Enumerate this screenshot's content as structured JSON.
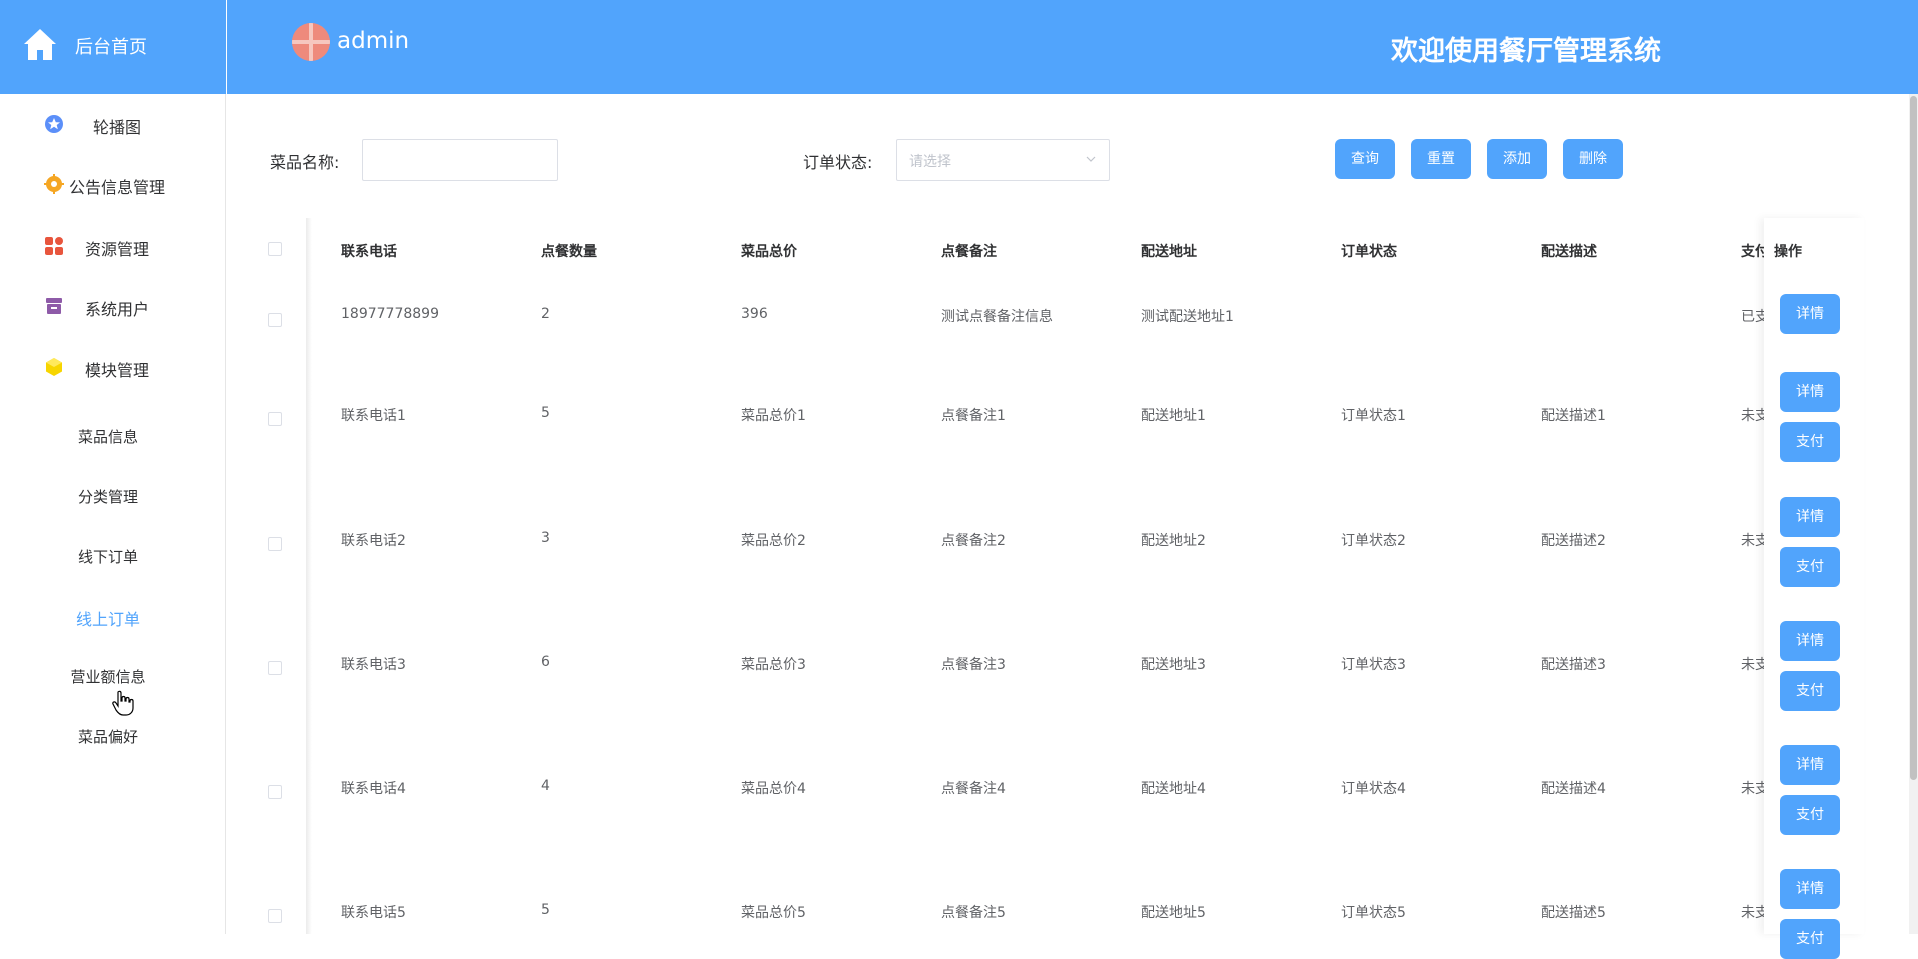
{
  "brand": {
    "label": "后台首页"
  },
  "header": {
    "user": "admin",
    "welcome": "欢迎使用餐厅管理系统"
  },
  "sidebar": {
    "items": [
      {
        "label": "轮播图",
        "icon": "star-icon"
      },
      {
        "label": "公告信息管理",
        "icon": "gear-icon"
      },
      {
        "label": "资源管理",
        "icon": "grid-icon"
      },
      {
        "label": "系统用户",
        "icon": "archive-icon"
      },
      {
        "label": "模块管理",
        "icon": "cube-icon"
      }
    ],
    "subitems": [
      {
        "label": "菜品信息"
      },
      {
        "label": "分类管理"
      },
      {
        "label": "线下订单"
      },
      {
        "label": "线上订单"
      },
      {
        "label": "营业额信息"
      },
      {
        "label": "菜品偏好"
      }
    ]
  },
  "search": {
    "name_label": "菜品名称:",
    "name_value": "",
    "status_label": "订单状态:",
    "status_placeholder": "请选择"
  },
  "toolbar": {
    "query": "查询",
    "reset": "重置",
    "add": "添加",
    "delete": "删除"
  },
  "table": {
    "headers": [
      "联系电话",
      "点餐数量",
      "菜品总价",
      "点餐备注",
      "配送地址",
      "订单状态",
      "配送描述",
      "支付",
      "操作"
    ],
    "rows": [
      {
        "phone": "18977778899",
        "qty": "2",
        "total": "396",
        "note": "测试点餐备注信息",
        "address": "测试配送地址1",
        "status": "",
        "desc": "",
        "pay": "已支"
      },
      {
        "phone": "联系电话1",
        "qty": "5",
        "total": "菜品总价1",
        "note": "点餐备注1",
        "address": "配送地址1",
        "status": "订单状态1",
        "desc": "配送描述1",
        "pay": "未支"
      },
      {
        "phone": "联系电话2",
        "qty": "3",
        "total": "菜品总价2",
        "note": "点餐备注2",
        "address": "配送地址2",
        "status": "订单状态2",
        "desc": "配送描述2",
        "pay": "未支"
      },
      {
        "phone": "联系电话3",
        "qty": "6",
        "total": "菜品总价3",
        "note": "点餐备注3",
        "address": "配送地址3",
        "status": "订单状态3",
        "desc": "配送描述3",
        "pay": "未支"
      },
      {
        "phone": "联系电话4",
        "qty": "4",
        "total": "菜品总价4",
        "note": "点餐备注4",
        "address": "配送地址4",
        "status": "订单状态4",
        "desc": "配送描述4",
        "pay": "未支"
      },
      {
        "phone": "联系电话5",
        "qty": "5",
        "total": "菜品总价5",
        "note": "点餐备注5",
        "address": "配送地址5",
        "status": "订单状态5",
        "desc": "配送描述5",
        "pay": "未支"
      }
    ],
    "op_detail": "详情",
    "op_pay": "支付"
  },
  "colors": {
    "primary": "#51a4fc",
    "active_text": "#51a4fc"
  }
}
